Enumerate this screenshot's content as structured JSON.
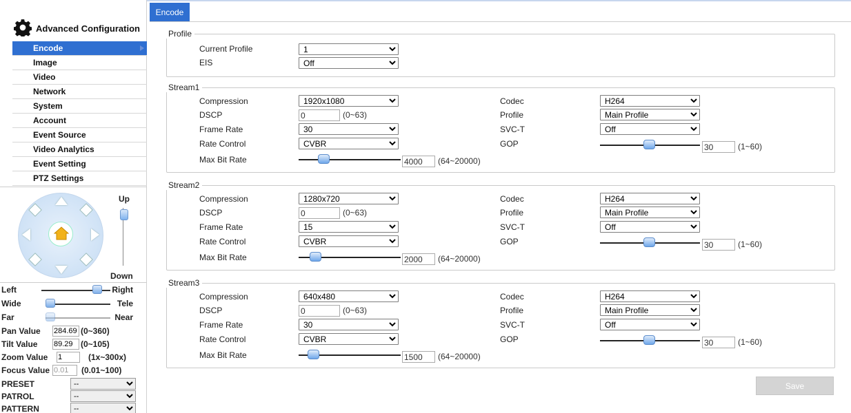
{
  "sidebar": {
    "title": "Advanced Configuration",
    "menu": [
      "Encode",
      "Image",
      "Video",
      "Network",
      "System",
      "Account",
      "Event Source",
      "Video Analytics",
      "Event Setting",
      "PTZ Settings"
    ],
    "ptz": {
      "up": "Up",
      "down": "Down",
      "left": "Left",
      "right": "Right",
      "wide": "Wide",
      "tele": "Tele",
      "far": "Far",
      "near": "Near",
      "pan_label": "Pan Value",
      "pan_value": "284.69",
      "pan_range": "(0~360)",
      "tilt_label": "Tilt Value",
      "tilt_value": "89.29",
      "tilt_range": "(0~105)",
      "zoom_label": "Zoom Value",
      "zoom_value": "1",
      "zoom_range": "(1x~300x)",
      "focus_label": "Focus Value",
      "focus_value": "0.01",
      "focus_range": "(0.01~100)",
      "preset_label": "PRESET",
      "preset_value": "--",
      "patrol_label": "PATROL",
      "patrol_value": "--",
      "pattern_label": "PATTERN",
      "pattern_value": "--"
    }
  },
  "tab": "Encode",
  "profile": {
    "legend": "Profile",
    "current_profile_label": "Current Profile",
    "current_profile_value": "1",
    "eis_label": "EIS",
    "eis_value": "Off"
  },
  "labels": {
    "compression": "Compression",
    "dscp": "DSCP",
    "frame_rate": "Frame Rate",
    "rate_control": "Rate Control",
    "max_bit_rate": "Max Bit Rate",
    "codec": "Codec",
    "profile": "Profile",
    "svct": "SVC-T",
    "gop": "GOP",
    "dscp_range": "(0~63)",
    "bitrate_range": "(64~20000)",
    "gop_range": "(1~60)"
  },
  "streams": [
    {
      "legend": "Stream1",
      "compression": "1920x1080",
      "dscp": "0",
      "frame_rate": "30",
      "rate_control": "CVBR",
      "max_bit_rate": "4000",
      "codec": "H264",
      "profile": "Main Profile",
      "svct": "Off",
      "gop": "30"
    },
    {
      "legend": "Stream2",
      "compression": "1280x720",
      "dscp": "0",
      "frame_rate": "15",
      "rate_control": "CVBR",
      "max_bit_rate": "2000",
      "codec": "H264",
      "profile": "Main Profile",
      "svct": "Off",
      "gop": "30"
    },
    {
      "legend": "Stream3",
      "compression": "640x480",
      "dscp": "0",
      "frame_rate": "30",
      "rate_control": "CVBR",
      "max_bit_rate": "1500",
      "codec": "H264",
      "profile": "Main Profile",
      "svct": "Off",
      "gop": "30"
    }
  ],
  "save_label": "Save",
  "colors": {
    "accent": "#2f6fd1",
    "save_disabled": "#d4d4d4"
  }
}
